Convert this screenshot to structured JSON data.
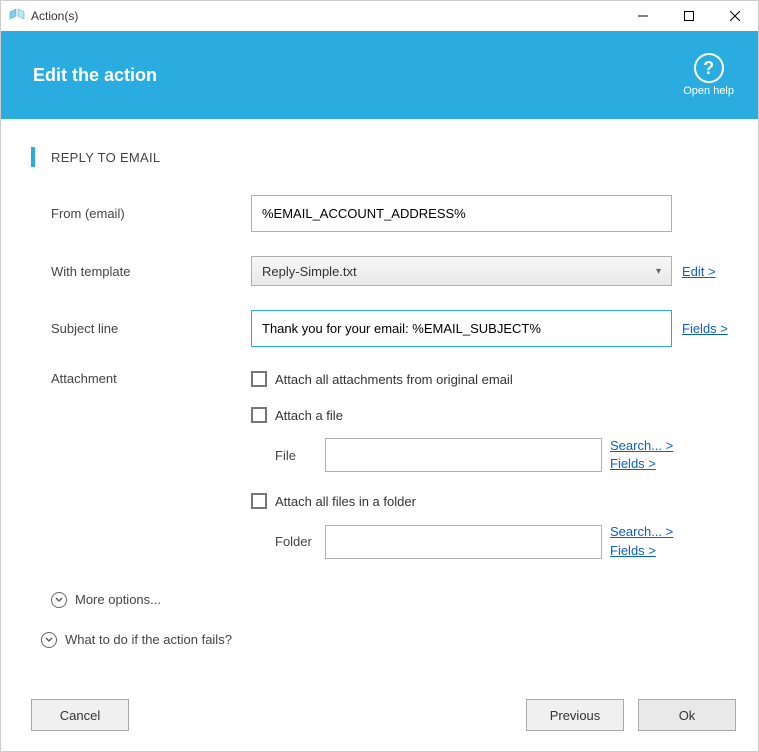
{
  "window": {
    "title": "Action(s)"
  },
  "header": {
    "title": "Edit the action",
    "help_label": "Open help"
  },
  "section": {
    "title": "REPLY TO EMAIL"
  },
  "form": {
    "from": {
      "label": "From (email)",
      "value": "%EMAIL_ACCOUNT_ADDRESS%"
    },
    "template": {
      "label": "With template",
      "selected": "Reply-Simple.txt",
      "edit_link": "Edit >"
    },
    "subject": {
      "label": "Subject line",
      "value": "Thank you for your email: %EMAIL_SUBJECT%",
      "fields_link": "Fields >"
    },
    "attachment": {
      "label": "Attachment",
      "attach_original": "Attach all attachments from original email",
      "attach_file": "Attach a file",
      "file_label": "File",
      "file_value": "",
      "file_search_link": "Search... >",
      "file_fields_link": "Fields >",
      "attach_folder": "Attach all files in a folder",
      "folder_label": "Folder",
      "folder_value": "",
      "folder_search_link": "Search... >",
      "folder_fields_link": "Fields >"
    },
    "more_options": "More options...",
    "on_fail": "What to do if the action fails?"
  },
  "footer": {
    "cancel": "Cancel",
    "previous": "Previous",
    "ok": "Ok"
  }
}
